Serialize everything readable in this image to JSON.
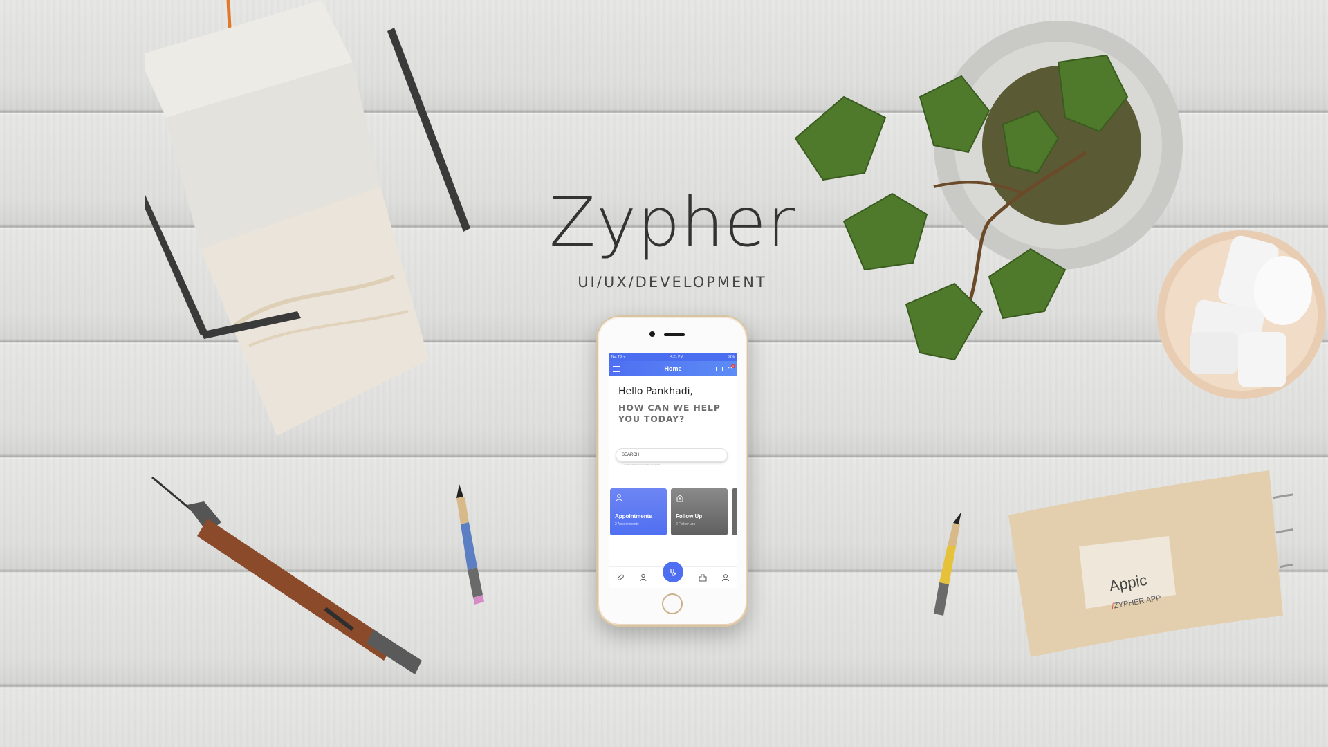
{
  "hero": {
    "title": "Zypher",
    "subtitle": "UI/UX/DEVELOPMENT"
  },
  "phone": {
    "status": {
      "carrier": "No. T3 ᯤ",
      "time": "4:21 PM",
      "battery": "31%"
    },
    "app_bar": {
      "title": "Home",
      "notification_count": "1"
    },
    "greeting": "Hello Pankhadi,",
    "help_line1": "HOW CAN WE HELP",
    "help_line2": "YOU TODAY?",
    "search": {
      "placeholder": "SEARCH",
      "hint": "ex: Search doctors/specialties/hospitals"
    },
    "cards": [
      {
        "title": "Appointments",
        "subtitle": "2 Appointments",
        "icon": "doctor-icon"
      },
      {
        "title": "Follow Up",
        "subtitle": "2 Follow ups",
        "icon": "hospital-icon"
      }
    ],
    "bottom_nav": [
      "pill-icon",
      "doctor-icon",
      "stethoscope-icon",
      "hospital-icon",
      "user-icon"
    ]
  },
  "notebook": {
    "brand": "Appic",
    "tag_slash": "/",
    "tag": "ZYPHER APP"
  },
  "colors": {
    "accent": "#4f6ff2",
    "card_grey": "#6a6a6a",
    "title_text": "#333333",
    "badge": "#e53935"
  }
}
